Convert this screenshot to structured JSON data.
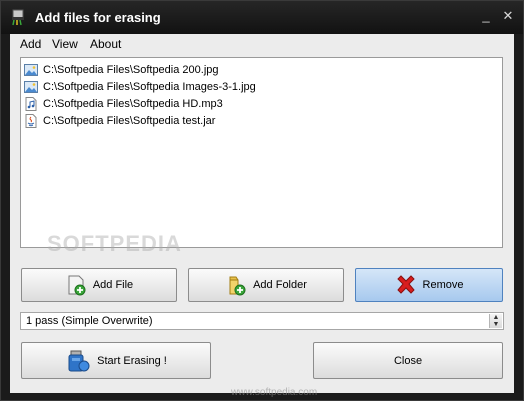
{
  "window": {
    "title": "Add files for erasing",
    "minimize_glyph": "_",
    "close_glyph": "✕"
  },
  "menubar": {
    "items": [
      {
        "label": "Add"
      },
      {
        "label": "View"
      },
      {
        "label": "About"
      }
    ]
  },
  "files": [
    {
      "path": "C:\\Softpedia Files\\Softpedia 200.jpg",
      "icon": "image-file-icon"
    },
    {
      "path": "C:\\Softpedia Files\\Softpedia Images-3-1.jpg",
      "icon": "image-file-icon"
    },
    {
      "path": "C:\\Softpedia Files\\Softpedia HD.mp3",
      "icon": "audio-file-icon"
    },
    {
      "path": "C:\\Softpedia Files\\Softpedia test.jar",
      "icon": "java-file-icon"
    }
  ],
  "buttons": {
    "add_file": "Add File",
    "add_folder": "Add Folder",
    "remove": "Remove",
    "start_erasing": "Start Erasing !",
    "close": "Close"
  },
  "method": {
    "selected": "1 pass (Simple Overwrite)"
  },
  "watermark": {
    "text": "SOFTPEDIA",
    "url": "www.softpedia.com"
  },
  "colors": {
    "titlebar": "#1a1a1a",
    "client": "#ececec",
    "primary_button": "#a7c9ee",
    "remove_x": "#d81e1e",
    "add_green": "#3aa63a"
  }
}
